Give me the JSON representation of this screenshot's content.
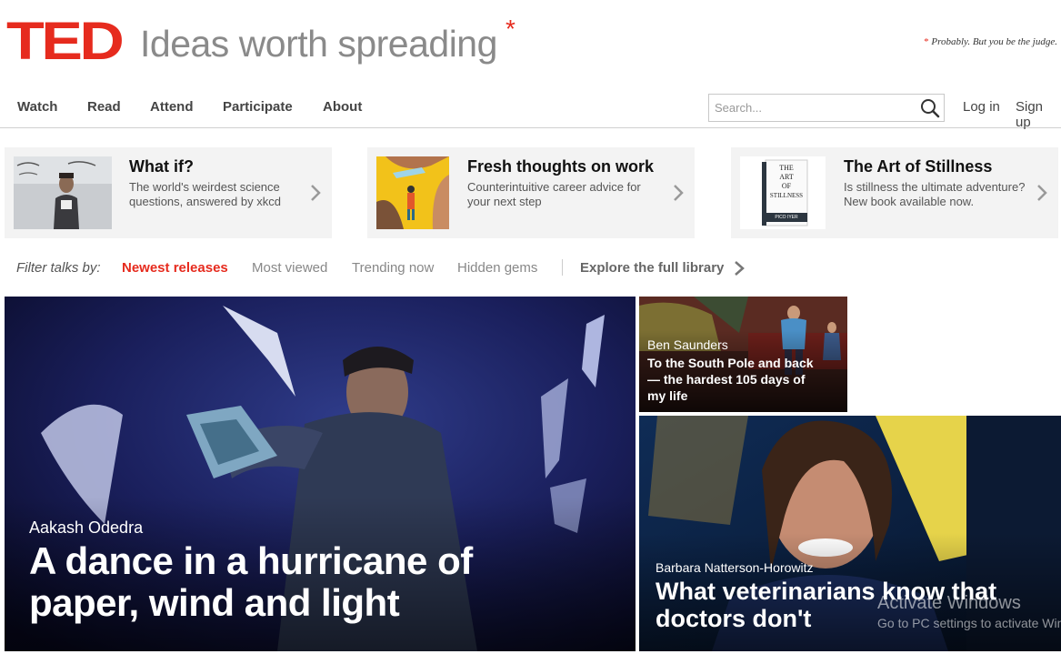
{
  "header": {
    "logo": "TED",
    "tagline": "Ideas worth spreading",
    "tagline_mark": "*",
    "disclaimer_mark": "*",
    "disclaimer": "Probably. But you be the judge."
  },
  "nav": {
    "items": [
      "Watch",
      "Read",
      "Attend",
      "Participate",
      "About"
    ],
    "search_placeholder": "Search...",
    "login": "Log in",
    "signup": "Sign up"
  },
  "promos": [
    {
      "title": "What if?",
      "description": "The world's weirdest science questions, answered by xkcd"
    },
    {
      "title": "Fresh thoughts on work",
      "description": "Counterintuitive career advice for your next step"
    },
    {
      "title": "The Art of Stillness",
      "description": "Is stillness the ultimate adventure? New book available now."
    }
  ],
  "promo_book": {
    "line1": "THE",
    "line2": "ART",
    "line3": "OF",
    "line4": "STILLNESS",
    "author": "PICO IYER"
  },
  "filter": {
    "label": "Filter talks by:",
    "items": [
      "Newest releases",
      "Most viewed",
      "Trending now",
      "Hidden gems"
    ],
    "explore": "Explore the full library"
  },
  "features": [
    {
      "speaker": "Aakash Odedra",
      "title_line1": "A dance in a hurricane of",
      "title_line2": "paper, wind and light"
    },
    {
      "speaker": "Ben Saunders",
      "title_line1": "To the South Pole and back",
      "title_line2": "— the hardest 105 days of",
      "title_line3": "my life"
    },
    {
      "speaker": "Barbara Natterson-Horowitz",
      "title_line1": "What veterinarians know that",
      "title_line2": "doctors don't"
    }
  ],
  "watermark": {
    "line1": "Activate Windows",
    "line2": "Go to PC settings to activate Windows."
  },
  "colors": {
    "brand_red": "#e62b1e",
    "nav_text": "#444444",
    "promo_bg": "#f3f3f3"
  }
}
